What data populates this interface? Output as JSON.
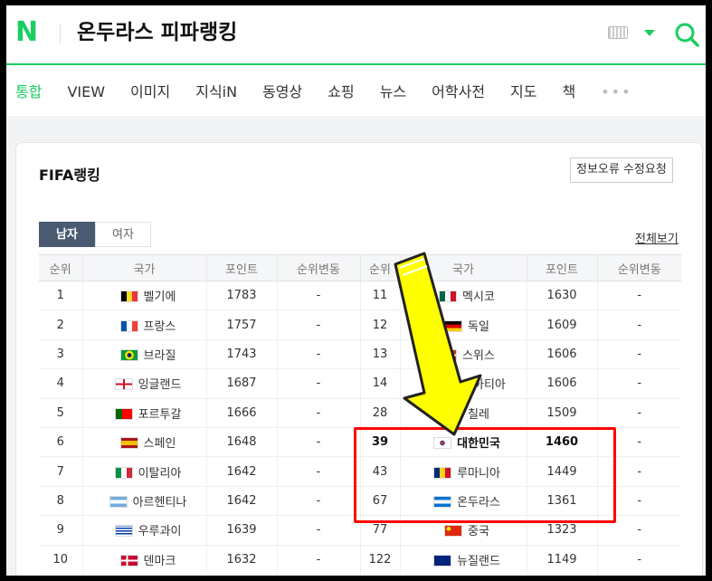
{
  "header": {
    "logo": "N",
    "query": "온두라스 피파랭킹",
    "icons": [
      "keyboard-icon",
      "dropdown-caret-icon",
      "search-icon"
    ],
    "brand_color": "#19ce60"
  },
  "tabs": [
    {
      "label": "통합",
      "active": true
    },
    {
      "label": "VIEW"
    },
    {
      "label": "이미지"
    },
    {
      "label": "지식iN"
    },
    {
      "label": "동영상"
    },
    {
      "label": "쇼핑"
    },
    {
      "label": "뉴스"
    },
    {
      "label": "어학사전"
    },
    {
      "label": "지도"
    },
    {
      "label": "책"
    }
  ],
  "more_label": "•••",
  "card": {
    "title": "FIFA랭킹",
    "report_label": "정보오류 수정요청",
    "gender_tabs": [
      "남자",
      "여자"
    ],
    "view_all": "전체보기",
    "columns": [
      "순위",
      "국가",
      "포인트",
      "순위변동",
      "순위",
      "국가",
      "포인트",
      "순위변동"
    ],
    "rows": [
      {
        "l": {
          "rank": "1",
          "country": "벨기에",
          "points": "1783",
          "change": "-"
        },
        "r": {
          "rank": "11",
          "country": "멕시코",
          "points": "1630",
          "change": "-"
        }
      },
      {
        "l": {
          "rank": "2",
          "country": "프랑스",
          "points": "1757",
          "change": "-"
        },
        "r": {
          "rank": "12",
          "country": "독일",
          "points": "1609",
          "change": "-"
        }
      },
      {
        "l": {
          "rank": "3",
          "country": "브라질",
          "points": "1743",
          "change": "-"
        },
        "r": {
          "rank": "13",
          "country": "스위스",
          "points": "1606",
          "change": "-"
        }
      },
      {
        "l": {
          "rank": "4",
          "country": "잉글랜드",
          "points": "1687",
          "change": "-"
        },
        "r": {
          "rank": "14",
          "country": "크로아티아",
          "points": "1606",
          "change": "-"
        }
      },
      {
        "l": {
          "rank": "5",
          "country": "포르투갈",
          "points": "1666",
          "change": "-"
        },
        "r": {
          "rank": "28",
          "country": "칠레",
          "points": "1509",
          "change": "-"
        }
      },
      {
        "l": {
          "rank": "6",
          "country": "스페인",
          "points": "1648",
          "change": "-"
        },
        "r": {
          "rank": "39",
          "country": "대한민국",
          "points": "1460",
          "change": "-",
          "bold": true
        }
      },
      {
        "l": {
          "rank": "7",
          "country": "이탈리아",
          "points": "1642",
          "change": "-"
        },
        "r": {
          "rank": "43",
          "country": "루마니아",
          "points": "1449",
          "change": "-"
        }
      },
      {
        "l": {
          "rank": "8",
          "country": "아르헨티나",
          "points": "1642",
          "change": "-"
        },
        "r": {
          "rank": "67",
          "country": "온두라스",
          "points": "1361",
          "change": "-"
        }
      },
      {
        "l": {
          "rank": "9",
          "country": "우루과이",
          "points": "1639",
          "change": "-"
        },
        "r": {
          "rank": "77",
          "country": "중국",
          "points": "1323",
          "change": "-"
        }
      },
      {
        "l": {
          "rank": "10",
          "country": "덴마크",
          "points": "1632",
          "change": "-"
        },
        "r": {
          "rank": "122",
          "country": "뉴질랜드",
          "points": "1149",
          "change": "-"
        }
      }
    ]
  },
  "annotation_colors": {
    "box": "#ff0000",
    "arrow_fill": "#ffff00"
  }
}
